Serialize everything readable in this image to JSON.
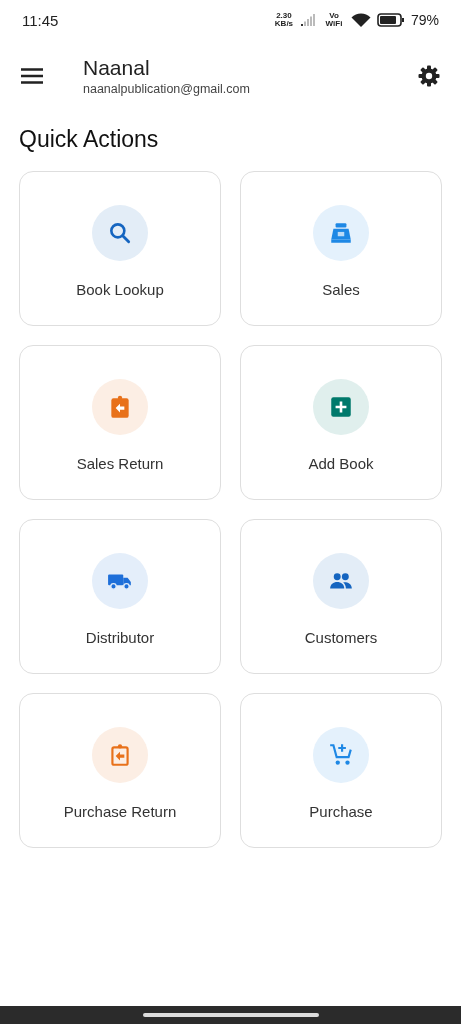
{
  "status_bar": {
    "time": "11:45",
    "speed": "2.30 KB/s",
    "network": "Vo WiFi",
    "battery": "79%"
  },
  "header": {
    "name": "Naanal",
    "email": "naanalpublication@gmail.com"
  },
  "section_title": "Quick Actions",
  "actions": [
    {
      "label": "Book Lookup",
      "kind": "search",
      "color": "#1565c0"
    },
    {
      "label": "Sales",
      "kind": "register",
      "color": "#1e88e5"
    },
    {
      "label": "Sales Return",
      "kind": "return",
      "color": "#e8711a"
    },
    {
      "label": "Add Book",
      "kind": "add",
      "color": "#00796b"
    },
    {
      "label": "Distributor",
      "kind": "truck",
      "color": "#1e6fd9"
    },
    {
      "label": "Customers",
      "kind": "people",
      "color": "#1565c0"
    },
    {
      "label": "Purchase Return",
      "kind": "return-outline",
      "color": "#e8711a"
    },
    {
      "label": "Purchase",
      "kind": "cart",
      "color": "#1e88e5"
    }
  ]
}
